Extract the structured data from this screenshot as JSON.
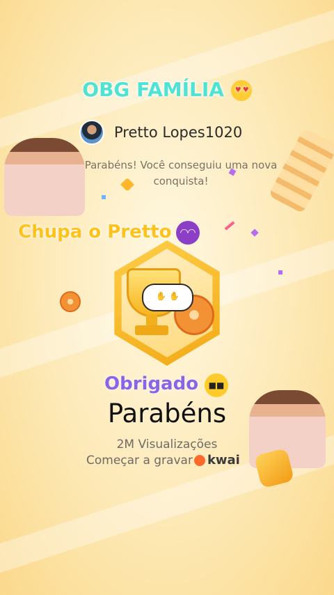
{
  "overlay": {
    "top_caption": "OBG FAMÍLIA",
    "top_caption_emoji": "smiling-face-with-heart-eyes-icon",
    "middle_caption": "Chupa o Pretto",
    "middle_caption_emoji": "smiling-devil-icon",
    "bottom_caption": "Obrigado",
    "bottom_caption_emoji": "sunglasses-face-icon"
  },
  "achievement": {
    "username": "Pretto Lopes1020",
    "message": "Parabéns! Você conseguiu uma nova conquista!",
    "badge_icon": "trophy-film-reel-icon",
    "stamp_icon": "clapping-hands-icon",
    "headline": "Parabéns",
    "views": "2M Visualizações",
    "record_label": "Começar a gravar",
    "brand": "kwai"
  },
  "colors": {
    "teal_caption": "#4fe3d6",
    "gold_caption": "#ffc21a",
    "purple_caption": "#8a64e6",
    "brand_orange": "#ff6a2b"
  }
}
